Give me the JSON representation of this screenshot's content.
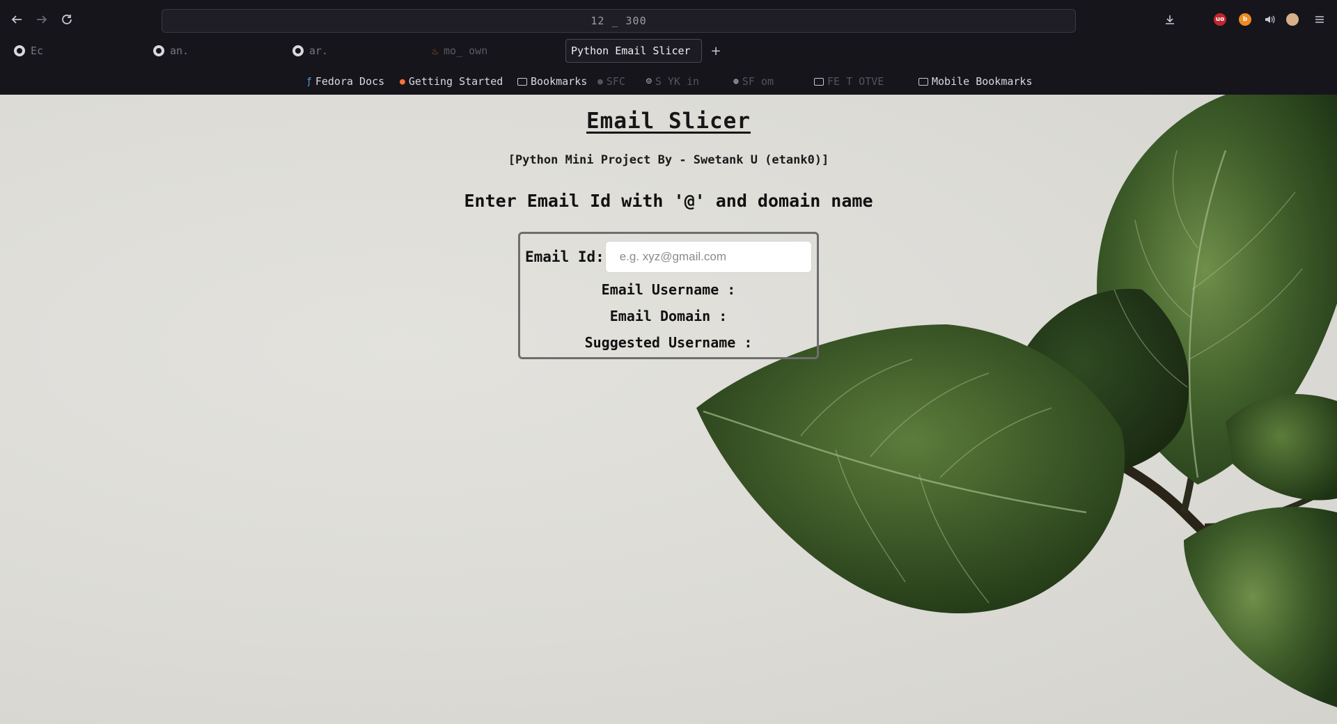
{
  "browser": {
    "url_text": "12 _ 300",
    "tabs": [
      {
        "label": "Ec",
        "faded": true
      },
      {
        "label": "an.",
        "faded": true
      },
      {
        "label": "ar.",
        "faded": true
      },
      {
        "label": "mo_ own ",
        "faded": true
      },
      {
        "label": "Python Email Slicer",
        "active": true
      }
    ],
    "new_tab_label": "+",
    "bookmarks": [
      {
        "label": "Fedora Docs",
        "icon": "fedora-icon"
      },
      {
        "label": "Getting Started",
        "icon": "firefox-icon"
      },
      {
        "label": "Bookmarks",
        "icon": "folder-icon"
      },
      {
        "label": "SFC",
        "icon": "site-icon",
        "faded": true
      },
      {
        "label": "S YK  in",
        "icon": "robot-icon",
        "faded": true
      },
      {
        "label": "SF  om",
        "icon": "globe-icon",
        "faded": true
      },
      {
        "label": "FE T  OTVE",
        "icon": "folder-icon",
        "faded": true
      },
      {
        "label": "Mobile Bookmarks",
        "icon": "folder-icon"
      }
    ],
    "extension_colors": {
      "ublock": "#c0272d",
      "brave": "#f08a24",
      "profile": "#d6b08a"
    }
  },
  "page": {
    "title": "Email Slicer",
    "subtitle": "[Python Mini Project By - Swetank U (etank0)]",
    "heading": "Enter Email Id with '@' and domain name",
    "form": {
      "email_label": "Email Id:",
      "email_value": "",
      "email_placeholder": "e.g. xyz@gmail.com",
      "username_label": "Email Username :",
      "domain_label": "Email Domain :",
      "suggested_label": "Suggested Username :"
    }
  }
}
